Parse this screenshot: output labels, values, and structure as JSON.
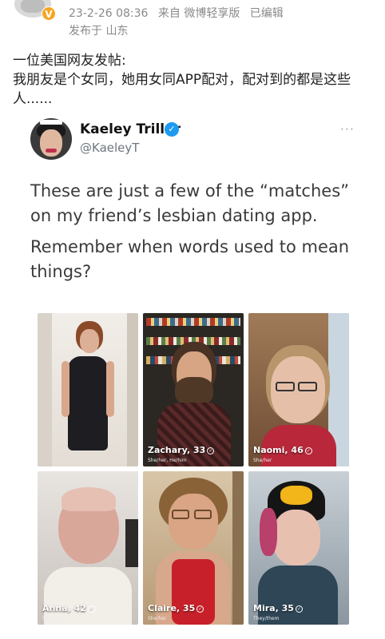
{
  "post": {
    "vip_badge": "V",
    "date": "23-2-26 08:36",
    "source": "来自 微博轻享版",
    "edited": "已编辑",
    "location": "发布于 山东",
    "text_line1": "一位美国网友发帖:",
    "text_line2": "我朋友是个女同，她用女同APP配对，配对到的都是这些人......"
  },
  "tweet": {
    "name": "Kaeley Triller",
    "handle": "@KaeleyT",
    "more": "···",
    "body_p1": "These are just a few of the “matches” on my friend’s lesbian dating app.",
    "body_p2": "Remember when words used to mean things?",
    "verified_icon": "check-badge-icon"
  },
  "photos": [
    {
      "label": "",
      "sub": ""
    },
    {
      "label": "Zachary, 33",
      "sub": "She/her, He/him"
    },
    {
      "label": "Naomi, 46",
      "sub": "She/her"
    },
    {
      "label": "Anna, 42",
      "sub": "She/her"
    },
    {
      "label": "Claire, 35",
      "sub": "She/her"
    },
    {
      "label": "Mira, 35",
      "sub": "They/them"
    }
  ]
}
